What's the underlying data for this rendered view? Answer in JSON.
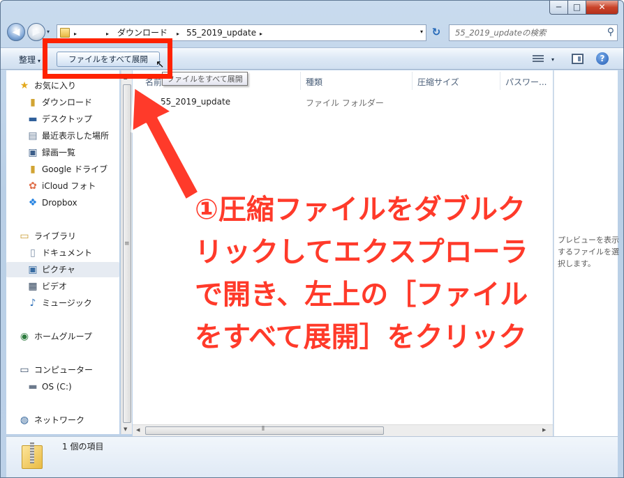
{
  "window": {
    "controls": {
      "minimize": "─",
      "maximize": "□",
      "close": "✕"
    }
  },
  "nav": {
    "back_glyph": "◀",
    "forward_glyph": "▶",
    "dropdown_glyph": "▾"
  },
  "address": {
    "crumbs": [
      "ダウンロード",
      "55_2019_update"
    ],
    "separator": "▸",
    "dropdown_glyph": "▾"
  },
  "refresh_glyph": "↻",
  "search": {
    "placeholder": "55_2019_updateの検索",
    "icon": "search-icon",
    "glyph": "⚲"
  },
  "toolbar": {
    "organize": "整理",
    "organize_caret": "▾",
    "extract_all": "ファイルをすべて展開",
    "view_caret": "▾",
    "help": "?"
  },
  "tooltip": "ファイルをすべて展開",
  "columns": {
    "name": "名前",
    "type": "種類",
    "compressed_size": "圧縮サイズ",
    "password": "パスワー..."
  },
  "rows": [
    {
      "name": "55_2019_update",
      "type": "ファイル フォルダー"
    }
  ],
  "sidebar": {
    "favorites": {
      "label": "お気に入り",
      "items": [
        {
          "label": "ダウンロード",
          "icon": "download-folder-icon"
        },
        {
          "label": "デスクトップ",
          "icon": "desktop-icon"
        },
        {
          "label": "最近表示した場所",
          "icon": "recent-places-icon"
        },
        {
          "label": "録画一覧",
          "icon": "recordings-icon"
        },
        {
          "label": "Google ドライブ",
          "icon": "google-drive-icon"
        },
        {
          "label": "iCloud フォト",
          "icon": "icloud-photos-icon"
        },
        {
          "label": "Dropbox",
          "icon": "dropbox-icon"
        }
      ]
    },
    "libraries": {
      "label": "ライブラリ",
      "items": [
        {
          "label": "ドキュメント",
          "icon": "documents-icon"
        },
        {
          "label": "ピクチャ",
          "icon": "pictures-icon",
          "selected": true
        },
        {
          "label": "ビデオ",
          "icon": "videos-icon"
        },
        {
          "label": "ミュージック",
          "icon": "music-icon"
        }
      ]
    },
    "homegroup": {
      "label": "ホームグループ"
    },
    "computer": {
      "label": "コンピューター",
      "items": [
        {
          "label": "OS (C:)",
          "icon": "drive-icon"
        }
      ]
    },
    "network": {
      "label": "ネットワーク"
    }
  },
  "preview": {
    "text": "プレビューを表示するファイルを選択します。"
  },
  "status": {
    "item_count": "1 個の項目"
  },
  "annotation": {
    "lines": [
      "①圧縮ファイルをダブルク",
      "リックしてエクスプローラ",
      "で開き、左上の［ファイル",
      "をすべて展開］をクリック"
    ],
    "color": "#ff3a2a",
    "highlight_color": "#ff2200"
  }
}
